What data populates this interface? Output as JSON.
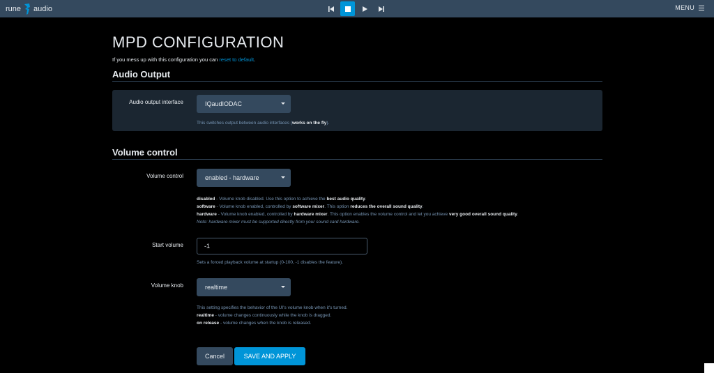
{
  "header": {
    "logo_left": "rune",
    "logo_right": "audio",
    "menu_label": "MENU",
    "colors": {
      "bar": "#34495e",
      "accent": "#0095d8"
    },
    "transport": [
      {
        "icon": "previous-icon"
      },
      {
        "icon": "stop-icon",
        "active": true
      },
      {
        "icon": "play-icon"
      },
      {
        "icon": "next-icon"
      }
    ]
  },
  "page": {
    "title": "MPD CONFIGURATION",
    "intro_text": "If you mess up with this configuration you can ",
    "intro_link": "reset to default",
    "intro_end": "."
  },
  "audio_output": {
    "section_title": "Audio Output",
    "label": "Audio output interface",
    "selected": "IQaudIODAC",
    "help_text": "This switches output between audio interfaces (",
    "help_bold": "works on the fly",
    "help_end": ")."
  },
  "volume": {
    "section_title": "Volume control",
    "control": {
      "label": "Volume control",
      "selected": "enabled - hardware",
      "help": {
        "disabled_key": "disabled",
        "disabled_text": " - Volume knob disabled. Use this option to achieve the ",
        "disabled_bold": "best audio quality",
        "disabled_end": ".",
        "software_key": "software",
        "software_text": " - Volume knob enabled, controlled by ",
        "software_bold1": "software mixer",
        "software_mid": ". This option ",
        "software_bold2": "reduces the overall sound quality",
        "software_end": ".",
        "hardware_key": "hardware",
        "hardware_text": " - Volume knob enabled, controlled by ",
        "hardware_bold1": "hardware mixer",
        "hardware_mid": ". This option enables the volume control and let you achieve ",
        "hardware_bold2": "very good overall sound quality",
        "hardware_end": ".",
        "note": "Note: hardware mixer must be supported directly from your sound card hardware."
      }
    },
    "start_volume": {
      "label": "Start volume",
      "value": "-1",
      "help": "Sets a forced playback volume at startup (0-100, -1 disables the feature)."
    },
    "knob": {
      "label": "Volume knob",
      "selected": "realtime",
      "help_intro": "This setting specifies the behavior of the UI's volume knob when it's turned.",
      "realtime_key": "realtime",
      "realtime_text": " - volume changes continuously while the knob is dragged.",
      "release_key": "on release",
      "release_text": " - volume changes when the knob is released."
    }
  },
  "actions": {
    "cancel_label": "Cancel",
    "save_label": "SAVE AND APPLY"
  }
}
